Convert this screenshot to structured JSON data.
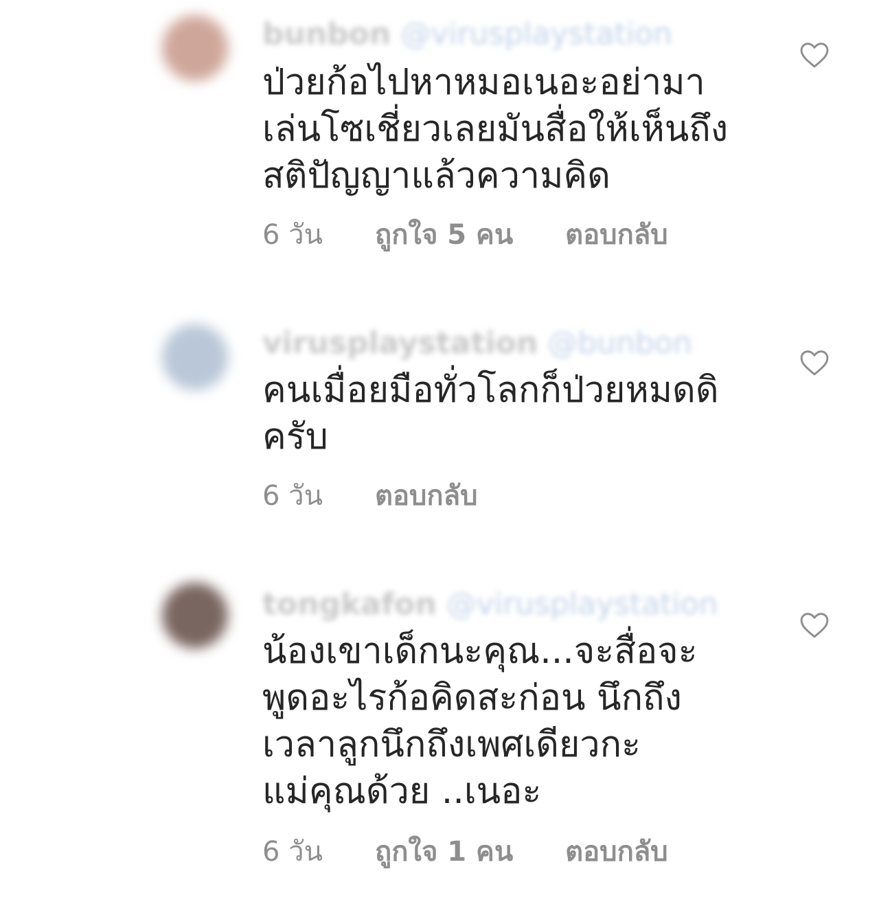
{
  "comments": [
    {
      "username": "bunbon",
      "mention": "@virusplaystation",
      "avatar_color": "#cfa79a",
      "text_lines": [
        "ป่วยก้อไปหาหมอเนอะอย่ามา",
        "เล่นโซเชี่ยวเลยมันสื่อให้เห็นถึง",
        "สติปัญญาแล้วความคิด"
      ],
      "time": "6 วัน",
      "likes": "ถูกใจ 5 คน",
      "reply": "ตอบกลับ",
      "like_icon": "heart-outline-icon"
    },
    {
      "username": "virusplaystation",
      "mention": "@bunbon",
      "avatar_color": "#b9c7d8",
      "text_lines": [
        "คนเมื่อยมือทั่วโลกก็ป่วยหมดดิ",
        "ครับ"
      ],
      "time": "6 วัน",
      "likes": "",
      "reply": "ตอบกลับ",
      "like_icon": "heart-outline-icon"
    },
    {
      "username": "tongkafon",
      "mention": "@virusplaystation",
      "avatar_color": "#7a6660",
      "text_lines": [
        "น้องเขาเด็กนะคุณ...จะสื่อจะ",
        "พูดอะไรก้อคิดสะก่อน  นึกถึง",
        "เวลาลูกนึกถึงเพศเดียวกะ",
        "แม่คุณด้วย ..เนอะ"
      ],
      "time": "6 วัน",
      "likes": "ถูกใจ 1 คน",
      "reply": "ตอบกลับ",
      "like_icon": "heart-outline-icon"
    }
  ],
  "colors": {
    "text": "#262626",
    "meta": "#8e8e8e",
    "heart_stroke": "#8e8e8e"
  }
}
